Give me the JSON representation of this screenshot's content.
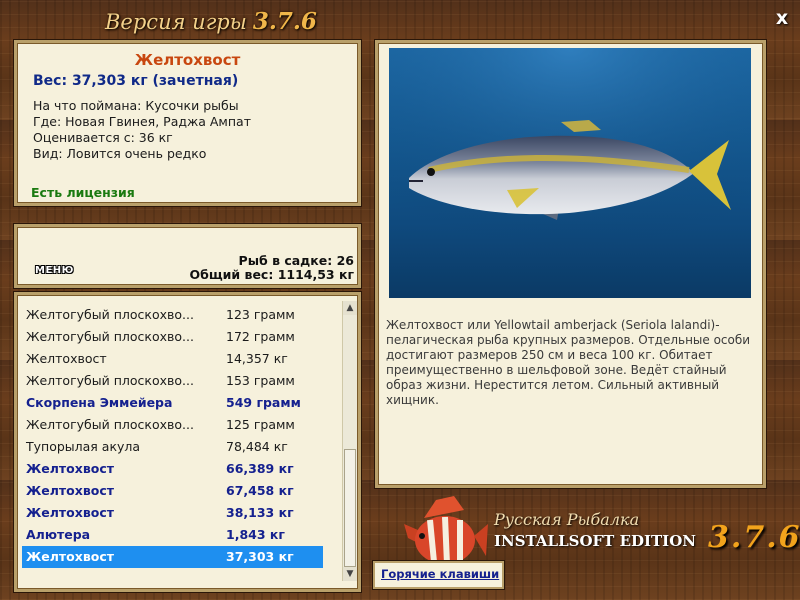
{
  "header": {
    "title": "Версия игры",
    "version": "3.7.6",
    "close_label": "x"
  },
  "fish_info": {
    "name": "Желтохвост",
    "weight": "Вес: 37,303 кг (зачетная)",
    "bait": "На что поймана: Кусочки рыбы",
    "location": "Где: Новая Гвинея, Раджа Ампат",
    "rated_from": "Оценивается с: 36 кг",
    "rarity": "Вид: Ловится очень редко",
    "license": "Есть лицензия"
  },
  "catch_summary": {
    "menu_label": "МЕНЮ",
    "fish_count": "Рыб в садке: 26",
    "total_weight": "Общий вес: 1114,53 кг"
  },
  "catch_list": [
    {
      "name": "Желтогубый плоскохво...",
      "weight": "123 грамм",
      "style": "normal"
    },
    {
      "name": "Желтогубый плоскохво...",
      "weight": "172 грамм",
      "style": "normal"
    },
    {
      "name": "Желтохвост",
      "weight": "14,357 кг",
      "style": "normal"
    },
    {
      "name": "Желтогубый плоскохво...",
      "weight": "153 грамм",
      "style": "normal"
    },
    {
      "name": "Скорпена Эммейера",
      "weight": "549 грамм",
      "style": "blue"
    },
    {
      "name": "Желтогубый плоскохво...",
      "weight": "125 грамм",
      "style": "normal"
    },
    {
      "name": "Тупорылая акула",
      "weight": "78,484 кг",
      "style": "normal"
    },
    {
      "name": "Желтохвост",
      "weight": "66,389 кг",
      "style": "blue"
    },
    {
      "name": "Желтохвост",
      "weight": "67,458 кг",
      "style": "blue"
    },
    {
      "name": "Желтохвост",
      "weight": "38,133 кг",
      "style": "blue"
    },
    {
      "name": "Алютера",
      "weight": "1,843 кг",
      "style": "blue"
    },
    {
      "name": "Желтохвост",
      "weight": "37,303 кг",
      "style": "selected"
    }
  ],
  "description": "Желтохвост или Yellowtail amberjack (Seriola lalandi)-пелагическая рыба крупных размеров. Отдельные особи достигают размеров 250 см и веса 100 кг. Обитает преимущественно в шельфовой зоне. Ведёт стайный образ жизни. Нерестится летом. Сильный активный хищник.",
  "logo": {
    "line1": "Русская Рыбалка",
    "line2": "INSTALLSOFT EDITION",
    "version": "3.7.6"
  },
  "hotkeys_label": "Горячие клавиши"
}
